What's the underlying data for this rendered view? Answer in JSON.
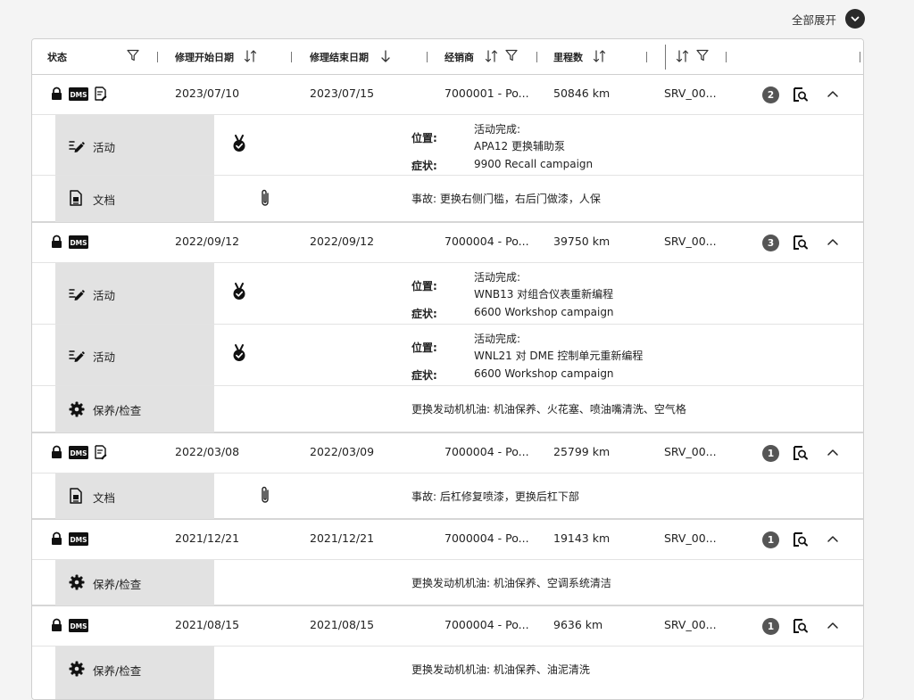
{
  "toolbar": {
    "expand_all_label": "全部展开"
  },
  "header": {
    "status": "状态",
    "start_date": "修理开始日期",
    "end_date": "修理结束日期",
    "dealer": "经销商",
    "mileage": "里程数"
  },
  "records": [
    {
      "start": "2023/07/10",
      "end": "2023/07/15",
      "dealer": "7000001 - Po...",
      "mileage": "50846 km",
      "service": "SRV_00...",
      "count": "2",
      "details": [
        {
          "category": "活动",
          "location_label": "位置:",
          "location_line1": "活动完成:",
          "location_line2": "APA12 更换辅助泵",
          "symptom_label": "症状:",
          "symptom": "9900 Recall campaign"
        },
        {
          "category": "文档",
          "text": "事故: 更换右侧门槛，右后门做漆，人保"
        }
      ]
    },
    {
      "start": "2022/09/12",
      "end": "2022/09/12",
      "dealer": "7000004 - Po...",
      "mileage": "39750 km",
      "service": "SRV_00...",
      "count": "3",
      "details": [
        {
          "category": "活动",
          "location_label": "位置:",
          "location_line1": "活动完成:",
          "location_line2": "WNB13 对组合仪表重新编程",
          "symptom_label": "症状:",
          "symptom": "6600 Workshop campaign"
        },
        {
          "category": "活动",
          "location_label": "位置:",
          "location_line1": "活动完成:",
          "location_line2": "WNL21 对 DME 控制单元重新编程",
          "symptom_label": "症状:",
          "symptom": "6600 Workshop campaign"
        },
        {
          "category": "保养/检查",
          "text": "更换发动机机油: 机油保养、火花塞、喷油嘴清洗、空气格"
        }
      ]
    },
    {
      "start": "2022/03/08",
      "end": "2022/03/09",
      "dealer": "7000004 - Po...",
      "mileage": "25799 km",
      "service": "SRV_00...",
      "count": "1",
      "details": [
        {
          "category": "文档",
          "text": "事故: 后杠修复喷漆，更换后杠下部"
        }
      ]
    },
    {
      "start": "2021/12/21",
      "end": "2021/12/21",
      "dealer": "7000004 - Po...",
      "mileage": "19143 km",
      "service": "SRV_00...",
      "count": "1",
      "details": [
        {
          "category": "保养/检查",
          "text": "更换发动机机油: 机油保养、空调系统清洁"
        }
      ]
    },
    {
      "start": "2021/08/15",
      "end": "2021/08/15",
      "dealer": "7000004 - Po...",
      "mileage": "9636 km",
      "service": "SRV_00...",
      "count": "1",
      "details": [
        {
          "category": "保养/检查",
          "text": "更换发动机机油: 机油保养、油泥清洗"
        }
      ]
    }
  ]
}
